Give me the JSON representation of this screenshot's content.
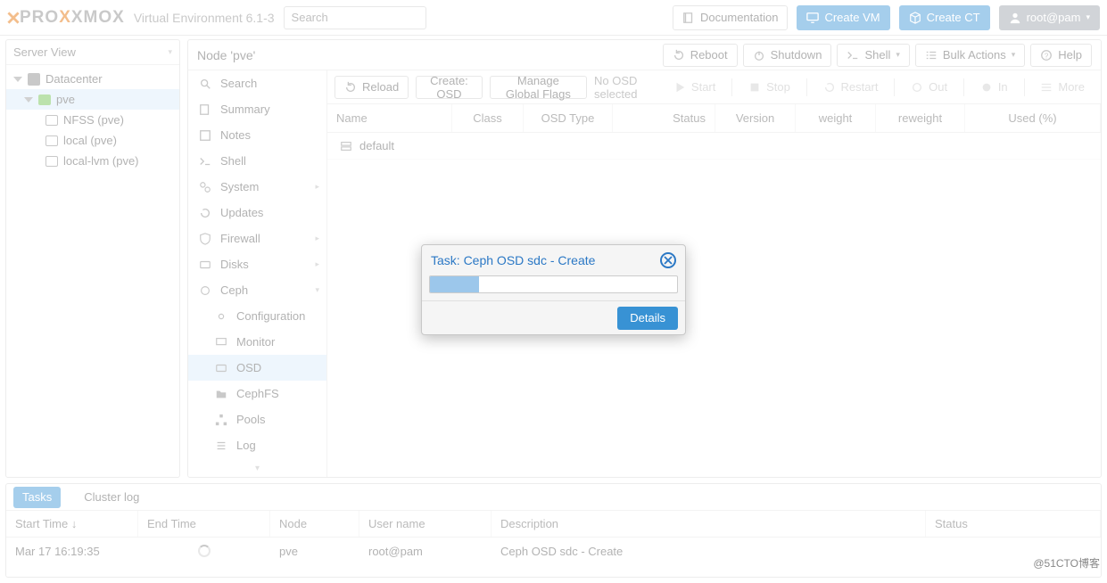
{
  "header": {
    "logo_text_pro": "PRO",
    "logo_text_xmox": "XMOX",
    "ve_label": "Virtual Environment 6.1-3",
    "search_placeholder": "Search",
    "documentation": "Documentation",
    "create_vm": "Create VM",
    "create_ct": "Create CT",
    "user": "root@pam"
  },
  "tree": {
    "view_label": "Server View",
    "datacenter": "Datacenter",
    "node": "pve",
    "storages": [
      "NFSS (pve)",
      "local (pve)",
      "local-lvm (pve)"
    ]
  },
  "main": {
    "title": "Node 'pve'",
    "reboot": "Reboot",
    "shutdown": "Shutdown",
    "shell": "Shell",
    "bulk": "Bulk Actions",
    "help": "Help",
    "side": {
      "search": "Search",
      "summary": "Summary",
      "notes": "Notes",
      "shell": "Shell",
      "system": "System",
      "updates": "Updates",
      "firewall": "Firewall",
      "disks": "Disks",
      "ceph": "Ceph",
      "configuration": "Configuration",
      "monitor": "Monitor",
      "osd": "OSD",
      "cephfs": "CephFS",
      "pools": "Pools",
      "log": "Log"
    },
    "toolbar": {
      "reload": "Reload",
      "create_osd": "Create: OSD",
      "manage_flags": "Manage Global Flags",
      "no_osd": "No OSD selected",
      "start": "Start",
      "stop": "Stop",
      "restart": "Restart",
      "out": "Out",
      "in": "In",
      "more": "More"
    },
    "cols": {
      "name": "Name",
      "class": "Class",
      "osd_type": "OSD Type",
      "status": "Status",
      "version": "Version",
      "weight": "weight",
      "reweight": "reweight",
      "used": "Used (%)"
    },
    "row_default": "default"
  },
  "log": {
    "tasks": "Tasks",
    "cluster_log": "Cluster log",
    "cols": {
      "start": "Start Time ↓",
      "end": "End Time",
      "node": "Node",
      "user": "User name",
      "desc": "Description",
      "status": "Status"
    },
    "row": {
      "start": "Mar 17 16:19:35",
      "node": "pve",
      "user": "root@pam",
      "desc": "Ceph OSD sdc - Create"
    }
  },
  "dialog": {
    "title": "Task: Ceph OSD sdc - Create",
    "details": "Details"
  },
  "watermark": "@51CTO博客"
}
